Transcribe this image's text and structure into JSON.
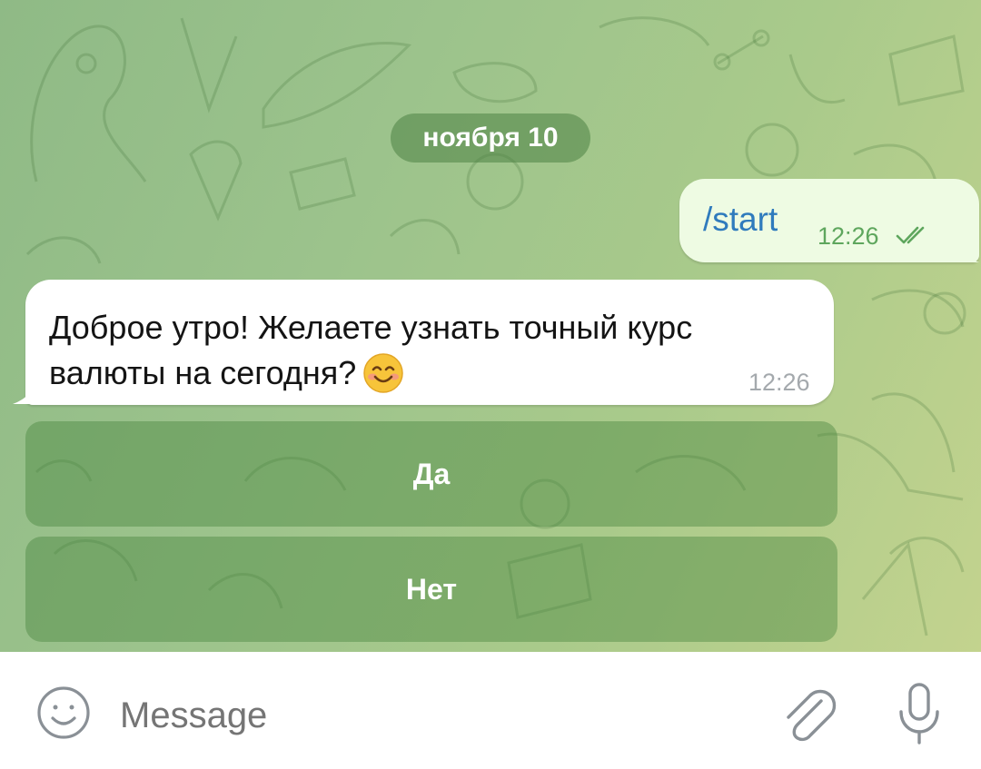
{
  "chat": {
    "date_label": "ноября 10",
    "outgoing": {
      "text": "/start",
      "time": "12:26",
      "status": "read"
    },
    "incoming": {
      "text": "Доброе утро! Желаете узнать точный курс валюты на сегодня?",
      "emoji": "smiling-face-emoji",
      "time": "12:26"
    },
    "keyboard": {
      "buttons": [
        "Да",
        "Нет"
      ]
    }
  },
  "composer": {
    "placeholder": "Message"
  },
  "colors": {
    "outgoing_bubble": "#eefbe3",
    "command_link": "#2f7bbd",
    "read_ticks": "#5ea65d",
    "button_bg": "#5a9a4c"
  }
}
